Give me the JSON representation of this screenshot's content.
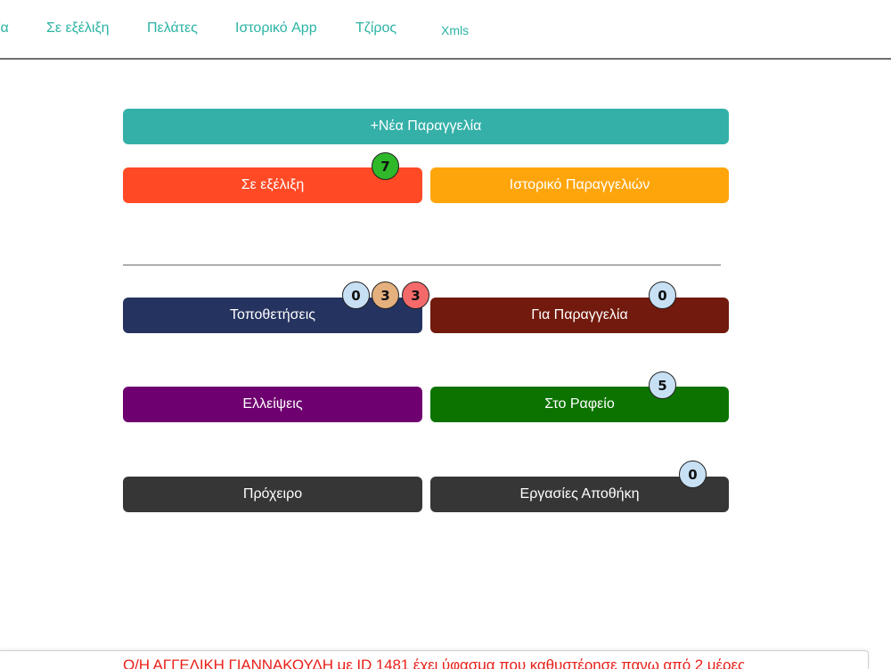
{
  "nav": {
    "items": [
      {
        "label": "ία"
      },
      {
        "label": "Σε εξέλιξη"
      },
      {
        "label": "Πελάτες"
      },
      {
        "label": "Ιστορικό App"
      },
      {
        "label": "Τζίρος"
      },
      {
        "label": "Xmls"
      }
    ]
  },
  "buttons": {
    "new_order": "+Νέα Παραγγελία",
    "in_progress": "Σε εξέλιξη",
    "order_history": "Ιστορικό Παραγγελιών",
    "placements": "Τοποθετήσεις",
    "to_order": "Για Παραγγελία",
    "shortages": "Ελλείψεις",
    "on_shelf": "Στο Ραφείο",
    "draft": "Πρόχειρο",
    "warehouse_tasks": "Εργασίες Αποθήκη"
  },
  "badges": {
    "in_progress_count": "7",
    "placements_blue": "0",
    "placements_orange": "3",
    "placements_red": "3",
    "to_order_count": "0",
    "on_shelf_count": "5",
    "warehouse_tasks_count": "0"
  },
  "colors": {
    "nav_text": "#2bb3a3",
    "new_order": "#34b0a8",
    "in_progress": "#ff4a25",
    "order_history": "#ffa50c",
    "placements": "#253360",
    "to_order": "#721a0d",
    "shortages": "#6e006f",
    "on_shelf": "#0c7300",
    "dark": "#363636",
    "badge_green": "#2fb82a",
    "badge_blue": "#c8e0f4",
    "badge_orange": "#e4b07e",
    "badge_red": "#f46a6a",
    "alert_text": "#e8201a"
  },
  "alert": {
    "message": "Ο/Η ΑΓΓΕΛΙΚΗ ΓΙΑΝΝΑΚΟΥΔΗ με ID 1481 έχει ύφασμα που καθυστέρησε πανω από 2 μέρες"
  }
}
